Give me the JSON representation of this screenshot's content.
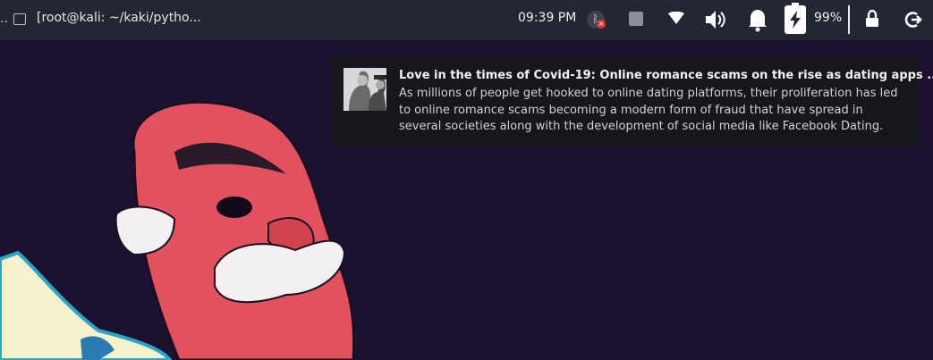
{
  "panel": {
    "overflow_glyph": "..",
    "window_title": "[root@kali: ~/kaki/pytho...",
    "clock": "09:39 PM",
    "battery_percent": "99%",
    "icons": [
      "terminal-icon",
      "bluetooth-icon",
      "app-indicator-icon",
      "wifi-icon",
      "volume-icon",
      "bell-icon",
      "battery-charging-icon",
      "lock-icon",
      "power-icon"
    ]
  },
  "notification": {
    "title": "Love in the times of Covid-19: Online romance scams on the rise as dating apps ...",
    "body": "As millions of people get hooked to online dating platforms, their proliferation has led to online romance scams becoming a modern form of fraud that have spread in several societies along with the development of social media like Facebook Dating."
  },
  "colors": {
    "panel_bg": "#232731",
    "desktop_bg": "#1d1130",
    "notification_bg": "#16171d",
    "mask_red": "#e2525e"
  }
}
